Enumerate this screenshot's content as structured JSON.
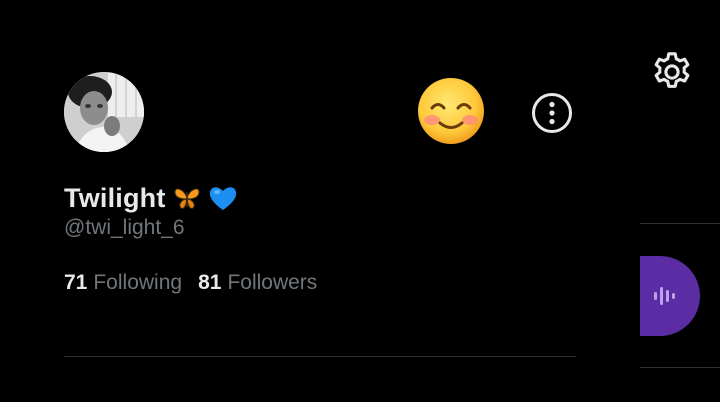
{
  "profile": {
    "display_name": "Twilight",
    "name_emojis": [
      "butterfly-emoji",
      "blue-heart-emoji"
    ],
    "handle": "@twi_light_6",
    "following_count": "71",
    "following_label": "Following",
    "followers_count": "81",
    "followers_label": "Followers"
  },
  "icons": {
    "emoji_button": "smiling-face-emoji",
    "more_button": "more-options-icon",
    "settings_button": "gear-icon",
    "spaces_button": "audio-waveform-icon"
  },
  "colors": {
    "background": "#000000",
    "primary_text": "#e7e9ea",
    "secondary_text": "#71767b",
    "divider": "#2f3336",
    "spaces_accent": "#5b2ca3"
  }
}
